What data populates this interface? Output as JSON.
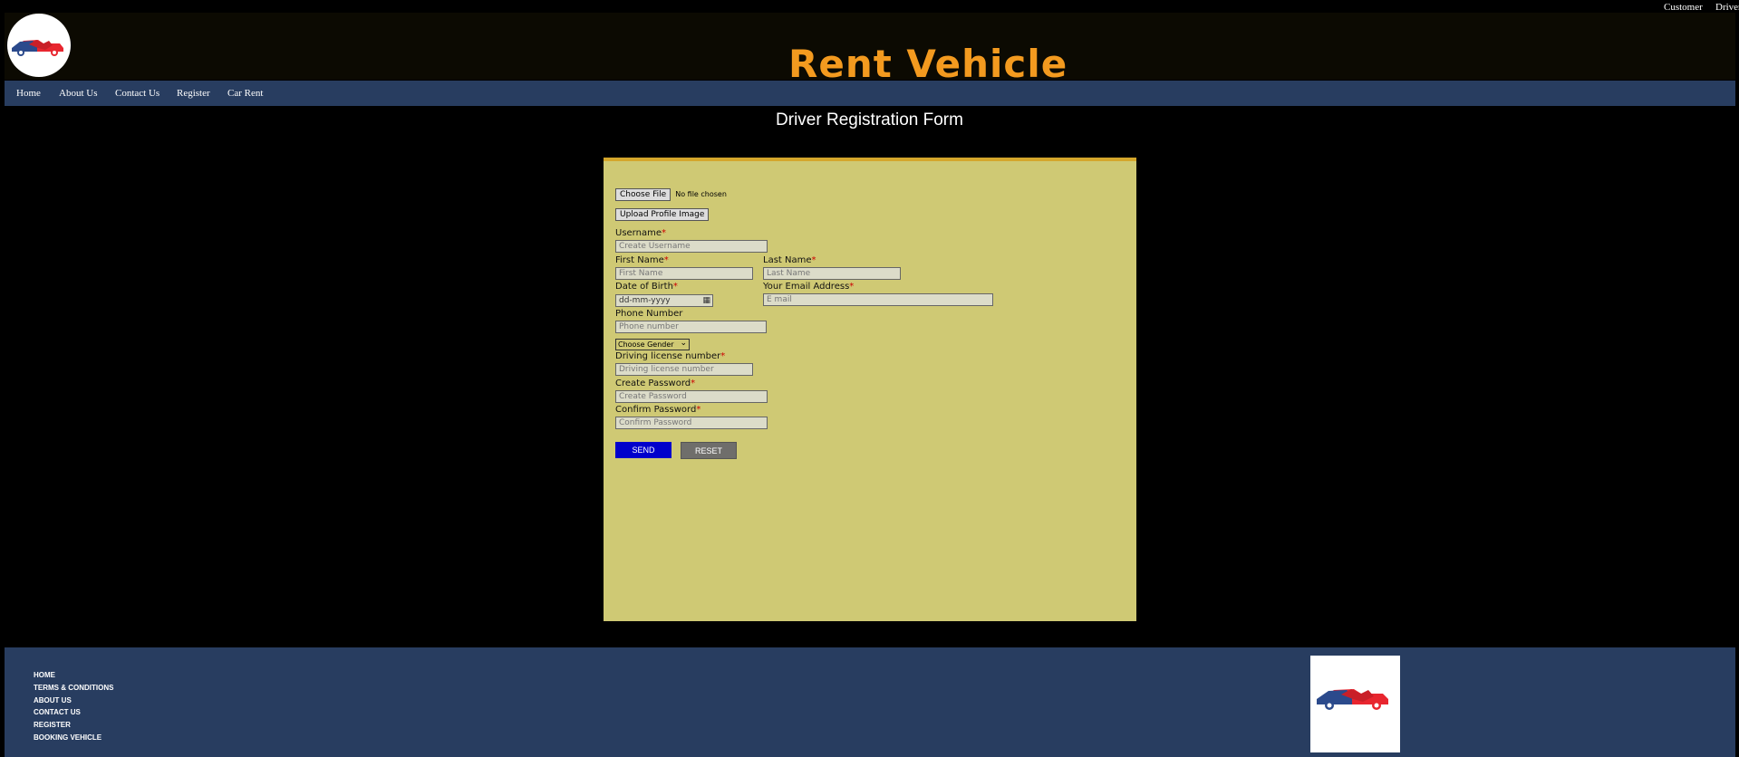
{
  "top_links": {
    "customer": "Customer",
    "driver": "Driver"
  },
  "header": {
    "title": "Rent Vehicle"
  },
  "nav": {
    "items": [
      "Home",
      "About Us",
      "Contact Us",
      "Register",
      "Car Rent"
    ]
  },
  "page": {
    "heading": "Driver Registration Form"
  },
  "form": {
    "file_button": "Choose File",
    "file_status": "No file chosen",
    "upload_button": "Upload Profile Image",
    "required_mark": "*",
    "username": {
      "label": "Username",
      "placeholder": "Create Username"
    },
    "first_name": {
      "label": "First Name",
      "placeholder": "First Name"
    },
    "last_name": {
      "label": "Last Name",
      "placeholder": "Last Name"
    },
    "dob": {
      "label": "Date of Birth",
      "placeholder": "dd-mm-yyyy"
    },
    "email": {
      "label": "Your Email Address",
      "placeholder": "E mail"
    },
    "phone": {
      "label": "Phone Number",
      "placeholder": "Phone number"
    },
    "gender": {
      "selected": "Choose Gender"
    },
    "license": {
      "label": "Driving license number",
      "placeholder": "Driving license number"
    },
    "password": {
      "label": "Create Password",
      "placeholder": "Create Password"
    },
    "confirm": {
      "label": "Confirm Password",
      "placeholder": "Confirm Password"
    },
    "send": "SEND",
    "reset": "RESET"
  },
  "footer": {
    "links": [
      "HOME",
      "TERMS & CONDITIONS",
      "ABOUT US",
      "CONTACT US",
      "REGISTER",
      "BOOKING VEHICLE"
    ]
  },
  "colors": {
    "accent": "#f39a1f",
    "nav_bg": "#283d60",
    "form_bg": "#cfc974",
    "send": "#0000cc"
  }
}
